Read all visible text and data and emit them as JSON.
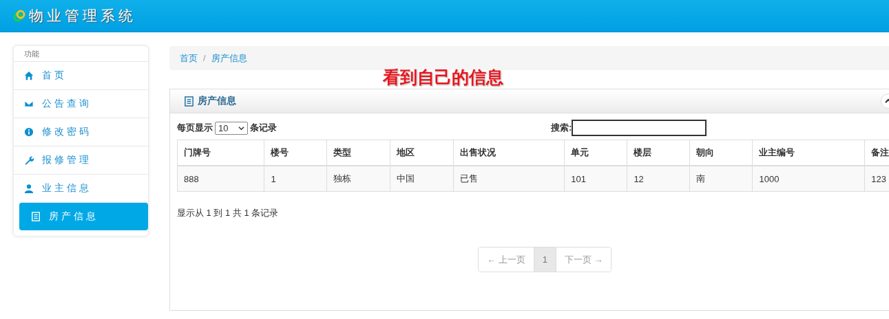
{
  "header": {
    "title": "物业管理系统"
  },
  "sidebar": {
    "heading": "功能",
    "items": [
      {
        "label": "首 页",
        "selected": false
      },
      {
        "label": "公 告 查 询",
        "selected": false
      },
      {
        "label": "修 改 密 码",
        "selected": false
      },
      {
        "label": "报 修 管 理",
        "selected": false
      },
      {
        "label": "业 主 信 息",
        "selected": false
      },
      {
        "label": "房 产 信 息",
        "selected": true
      }
    ]
  },
  "breadcrumb": [
    "首页",
    "房产信息"
  ],
  "breadcrumb_separator": "/",
  "annotation": "看到自己的信息",
  "panel": {
    "title": "房产信息",
    "page_size": {
      "before": "每页显示",
      "value": "10",
      "after": "条记录"
    },
    "search": {
      "label": "搜索:"
    },
    "table": {
      "columns": [
        "门牌号",
        "楼号",
        "类型",
        "地区",
        "出售状况",
        "单元",
        "楼层",
        "朝向",
        "业主编号",
        "备注"
      ],
      "rows": [
        [
          "888",
          "1",
          "独栋",
          "中国",
          "已售",
          "101",
          "12",
          "南",
          "1000",
          "123"
        ]
      ]
    },
    "info": "显示从 1 到 1 共 1 条记录",
    "pagination": [
      {
        "label": "← 上一页",
        "disabled": true,
        "selected": false
      },
      {
        "label": "1",
        "disabled": false,
        "selected": true
      },
      {
        "label": "下一页 →",
        "disabled": true,
        "selected": false
      }
    ]
  }
}
